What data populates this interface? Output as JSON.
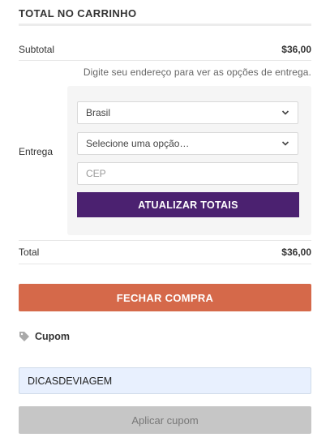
{
  "cart_totals": {
    "heading": "TOTAL NO CARRINHO",
    "subtotal": {
      "label": "Subtotal",
      "value": "$36,00"
    },
    "shipping": {
      "label": "Entrega",
      "hint": "Digite seu endereço para ver as opções de entrega.",
      "country_select": {
        "value": "Brasil"
      },
      "state_select": {
        "value": "Selecione uma opção…"
      },
      "postcode_input": {
        "placeholder": "CEP",
        "value": ""
      },
      "update_button_label": "ATUALIZAR TOTAIS"
    },
    "total": {
      "label": "Total",
      "value": "$36,00"
    },
    "checkout_button_label": "FECHAR COMPRA"
  },
  "coupon": {
    "title": "Cupom",
    "icon": "tag-icon",
    "input_value": "DICASDEVIAGEM",
    "apply_button_label": "Aplicar cupom"
  },
  "colors": {
    "update_button": "#4b2170",
    "checkout_button": "#d5694a",
    "apply_button": "#c6c6c6",
    "coupon_input_bg": "#e8f0fe"
  }
}
